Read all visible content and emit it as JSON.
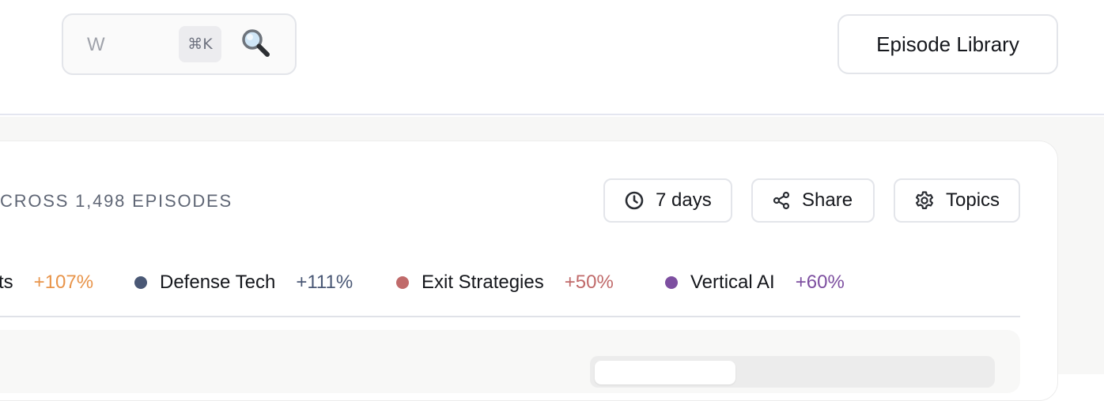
{
  "search": {
    "value": "W",
    "shortcut": "⌘K"
  },
  "header": {
    "library_label": "Episode Library"
  },
  "card": {
    "heading": "CROSS 1,498 EPISODES"
  },
  "filters": {
    "days_label": "7 days",
    "share_label": "Share",
    "topics_label": "Topics"
  },
  "trends": [
    {
      "name": "ts",
      "pct": "+107%",
      "color": "#e8944a"
    },
    {
      "name": "Defense Tech",
      "pct": "+111%",
      "color": "#4a5875"
    },
    {
      "name": "Exit Strategies",
      "pct": "+50%",
      "color": "#c06a6a"
    },
    {
      "name": "Vertical AI",
      "pct": "+60%",
      "color": "#7d4fa0"
    }
  ],
  "icons": {
    "search": "magnifier-icon",
    "clock": "clock-icon",
    "share": "share-icon",
    "gear": "gear-icon"
  }
}
